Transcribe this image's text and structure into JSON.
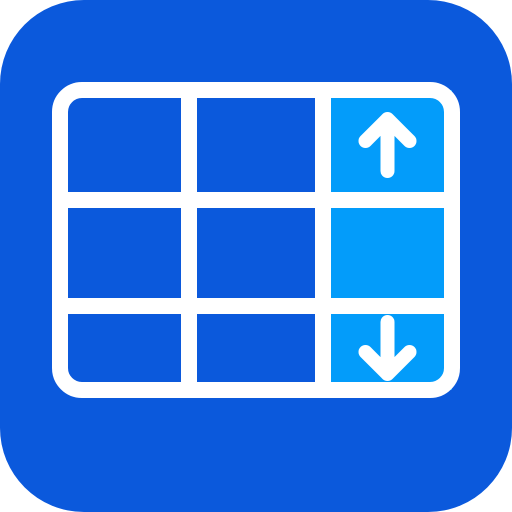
{
  "app_icon": {
    "icon_name": "table-column-sort-icon",
    "colors": {
      "tile_background": "#0B59DC",
      "grid_lines": "#FFFFFF",
      "cell_fill": "#0B59DC",
      "highlighted_column_fill": "#039CFA",
      "arrow_color": "#FFFFFF"
    },
    "grid": {
      "rows": 3,
      "columns": 3,
      "highlighted_column_index": 2
    },
    "arrows": [
      {
        "name": "arrow-up-icon",
        "direction": "up",
        "cell_row": 0,
        "cell_col": 2
      },
      {
        "name": "arrow-down-icon",
        "direction": "down",
        "cell_row": 2,
        "cell_col": 2
      }
    ]
  }
}
